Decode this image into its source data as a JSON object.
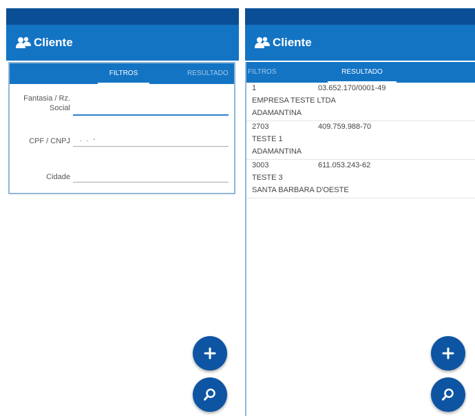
{
  "app": {
    "title": "Cliente",
    "icon": "users-icon"
  },
  "colors": {
    "status_bar": "#0a4f95",
    "app_bar": "#1474c4",
    "fab": "#0d55a3",
    "focus": "#2a7fd0"
  },
  "tabs": {
    "filters": "FILTROS",
    "results": "RESULTADO"
  },
  "filters": {
    "name_label": "Fantasia / Rz. Social",
    "cpf_label": "CPF / CNPJ",
    "cpf_mask": ". . -",
    "city_label": "Cidade"
  },
  "results": [
    {
      "id": "1",
      "document": "03.652.170/0001-49",
      "name": "EMPRESA TESTE LTDA",
      "city": "ADAMANTINA"
    },
    {
      "id": "2703",
      "document": "409.759.988-70",
      "name": "TESTE 1",
      "city": "ADAMANTINA"
    },
    {
      "id": "3003",
      "document": "611.053.243-62",
      "name": "TESTE 3",
      "city": "SANTA BARBARA D'OESTE"
    }
  ],
  "fab_icons": {
    "add": "plus-icon",
    "search": "search-icon"
  }
}
